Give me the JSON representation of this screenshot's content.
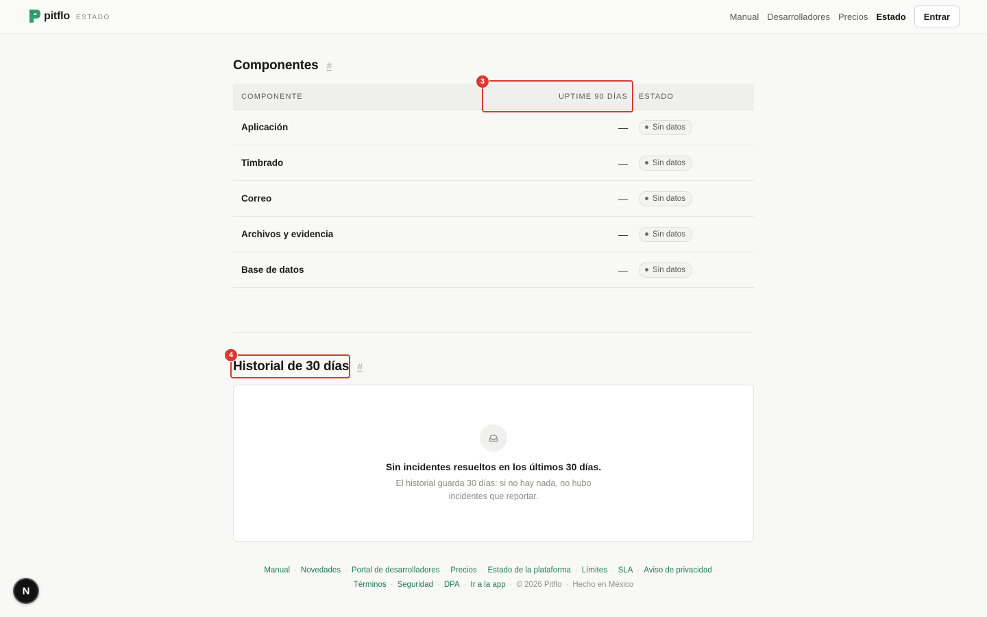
{
  "header": {
    "brand_name": "pitflo",
    "brand_tag": "ESTADO",
    "nav": [
      {
        "label": "Manual"
      },
      {
        "label": "Desarrolladores"
      },
      {
        "label": "Precios"
      },
      {
        "label": "Estado",
        "active": true
      }
    ],
    "login_label": "Entrar",
    "brand_color": "#2f9e6b"
  },
  "components": {
    "title": "Componentes",
    "anchor": "#",
    "columns": {
      "component": "COMPONENTE",
      "uptime": "UPTIME 90 DÍAS",
      "status": "ESTADO"
    },
    "rows": [
      {
        "name": "Aplicación",
        "uptime": "—",
        "status": "Sin datos"
      },
      {
        "name": "Timbrado",
        "uptime": "—",
        "status": "Sin datos"
      },
      {
        "name": "Correo",
        "uptime": "—",
        "status": "Sin datos"
      },
      {
        "name": "Archivos y evidencia",
        "uptime": "—",
        "status": "Sin datos"
      },
      {
        "name": "Base de datos",
        "uptime": "—",
        "status": "Sin datos"
      }
    ]
  },
  "history": {
    "title": "Historial de 30 días",
    "anchor": "#",
    "empty_icon": "inbox-icon",
    "empty_heading": "Sin incidentes resueltos en los últimos 30 días.",
    "empty_text": "El historial guarda 30 días: si no hay nada, no hubo incidentes que reportar."
  },
  "annotations": {
    "uptime_badge": "3",
    "history_badge": "4",
    "color": "#d83a2e"
  },
  "footer": {
    "links_row1": [
      "Manual",
      "Novedades",
      "Portal de desarrolladores",
      "Precios",
      "Estado de la plataforma",
      "Límites",
      "SLA",
      "Aviso de privacidad"
    ],
    "links_row2": [
      "Términos",
      "Seguridad",
      "DPA",
      "Ir a la app"
    ],
    "copyright": "© 2026 Pitflo",
    "made_in": "Hecho en México",
    "separator": "·",
    "link_color": "#1f7a52"
  },
  "dev_badge": "N"
}
